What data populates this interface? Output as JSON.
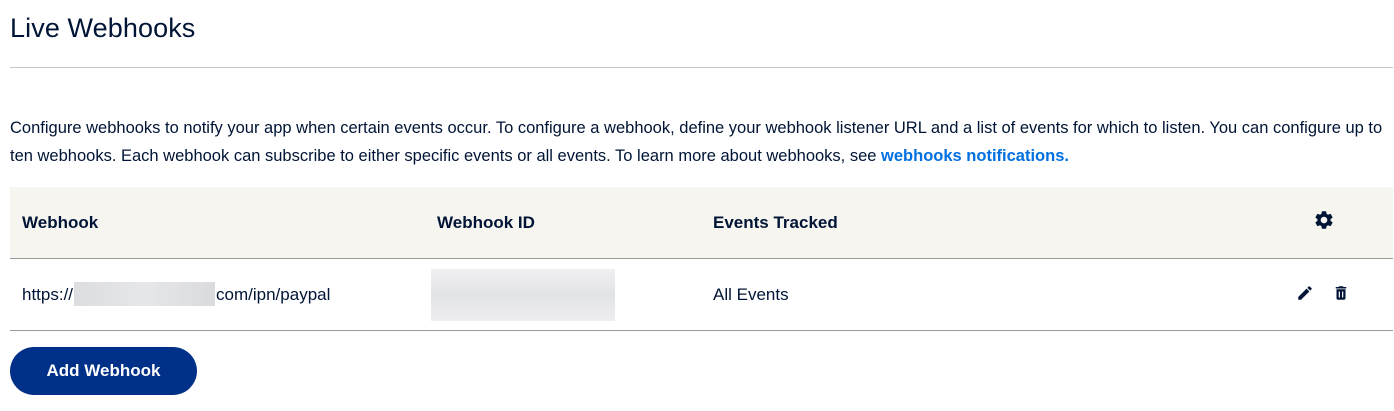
{
  "page": {
    "title": "Live Webhooks",
    "description_text": "Configure webhooks to notify your app when certain events occur. To configure a webhook, define your webhook listener URL and a list of events for which to listen. You can configure up to ten webhooks. Each webhook can subscribe to either specific events or all events. To learn more about webhooks, see ",
    "description_link": "webhooks notifications."
  },
  "table": {
    "columns": {
      "webhook": "Webhook",
      "webhook_id": "Webhook ID",
      "events": "Events Tracked",
      "settings_icon": "gear-icon"
    },
    "rows": [
      {
        "url_prefix": "https://",
        "url_suffix": "com/ipn/paypal",
        "webhook_id": "",
        "events": "All Events",
        "edit_icon": "pencil-icon",
        "delete_icon": "trash-icon"
      }
    ]
  },
  "actions": {
    "add_webhook_label": "Add Webhook"
  },
  "colors": {
    "text": "#001435",
    "link": "#0070e0",
    "button": "#003087",
    "header_bg": "#f7f5f0"
  }
}
